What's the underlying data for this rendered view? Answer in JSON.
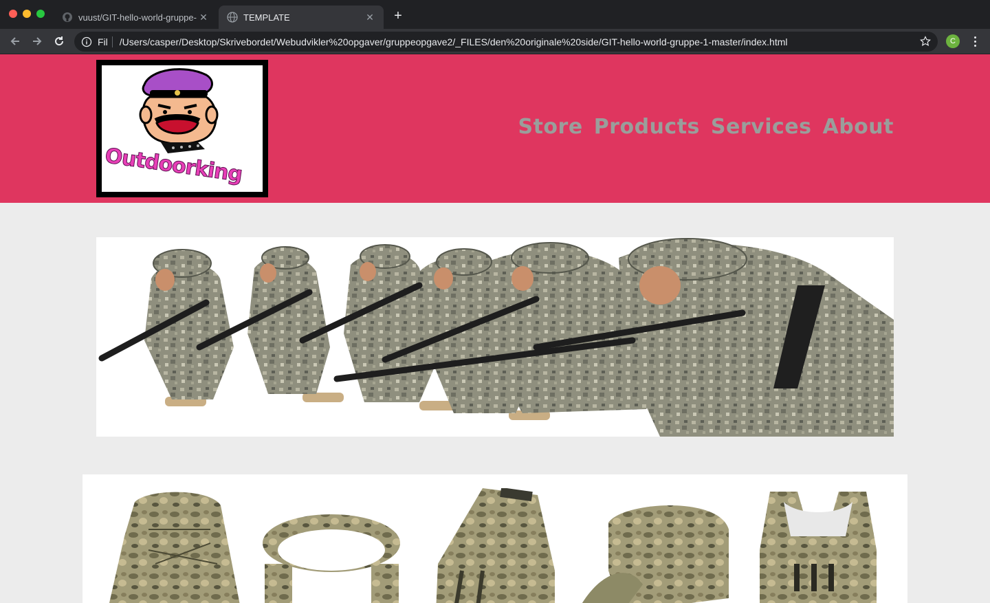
{
  "browser": {
    "tabs": [
      {
        "title": "vuust/GIT-hello-world-gruppe-",
        "active": false,
        "icon": "github-icon"
      },
      {
        "title": "TEMPLATE",
        "active": true,
        "icon": "globe-icon"
      }
    ],
    "address": {
      "scheme_label": "Fil",
      "url": "/Users/casper/Desktop/Skrivebordet/Webudvikler%20opgaver/gruppeopgave2/_FILES/den%20originale%20side/GIT-hello-world-gruppe-1-master/index.html"
    },
    "profile_initial": "C"
  },
  "site": {
    "logo_text": "Outdoorking",
    "nav": [
      {
        "label": "Store"
      },
      {
        "label": "Products"
      },
      {
        "label": "Services"
      },
      {
        "label": "About"
      }
    ],
    "colors": {
      "header_bg": "#df365f",
      "nav_text": "#9a9e9b",
      "page_bg": "#ececec"
    },
    "hero": {
      "subject": "soldiers in camouflage advancing with rifles"
    },
    "products": [
      {
        "item": "camo backpack"
      },
      {
        "item": "camo belt"
      },
      {
        "item": "camo gloves"
      },
      {
        "item": "camo cap"
      },
      {
        "item": "camo tactical vest"
      }
    ]
  }
}
